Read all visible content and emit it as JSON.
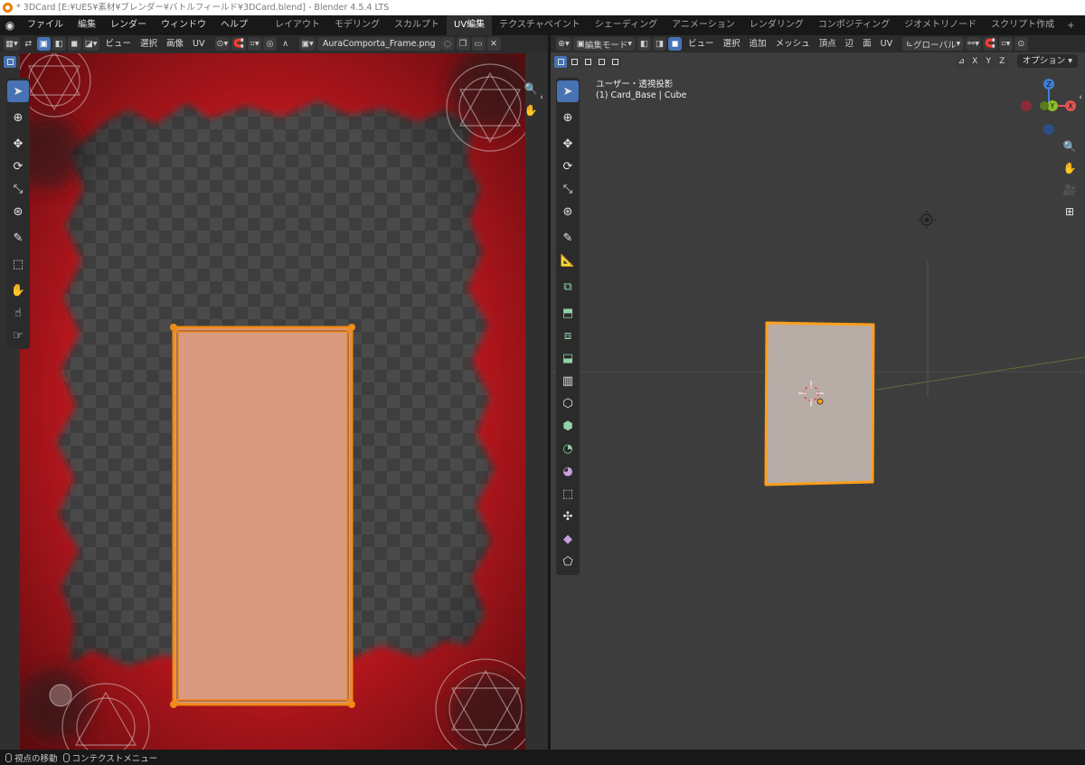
{
  "window": {
    "title": "* 3DCard [E:¥UES¥素材¥ブレンダー¥バトルフィールド¥3DCard.blend] - Blender 4.5.4 LTS"
  },
  "menubar": {
    "menus": [
      "ファイル",
      "編集",
      "レンダー",
      "ウィンドウ",
      "ヘルプ"
    ],
    "workspaces": [
      "レイアウト",
      "モデリング",
      "スカルプト",
      "UV編集",
      "テクスチャペイント",
      "シェーディング",
      "アニメーション",
      "レンダリング",
      "コンポジティング",
      "ジオメトリノード",
      "スクリプト作成"
    ],
    "active_workspace": "UV編集",
    "add_workspace": "+"
  },
  "uv_editor": {
    "menus": [
      "ビュー",
      "選択",
      "画像",
      "UV"
    ],
    "image_name": "AuraComporta_Frame.png",
    "frame_color": "#b3141c",
    "uv_fill_color": "#d99a82",
    "uv_edge_color": "#f08b17"
  },
  "viewport": {
    "mode": "編集モード",
    "menus": [
      "ビュー",
      "選択",
      "追加",
      "メッシュ",
      "頂点",
      "辺",
      "面",
      "UV"
    ],
    "orientation": "グローバル",
    "axes": [
      "X",
      "Y",
      "Z"
    ],
    "options": "オプション",
    "view_title": "ユーザー・透視投影",
    "object_info": "(1) Card_Base | Cube",
    "gizmo_labels": [
      "Z",
      "X",
      "Y"
    ],
    "card_color": "#b7aca6",
    "outline_color": "#ff9f1c"
  },
  "statusbar": {
    "items": [
      "視点の移動",
      "コンテクストメニュー"
    ]
  }
}
